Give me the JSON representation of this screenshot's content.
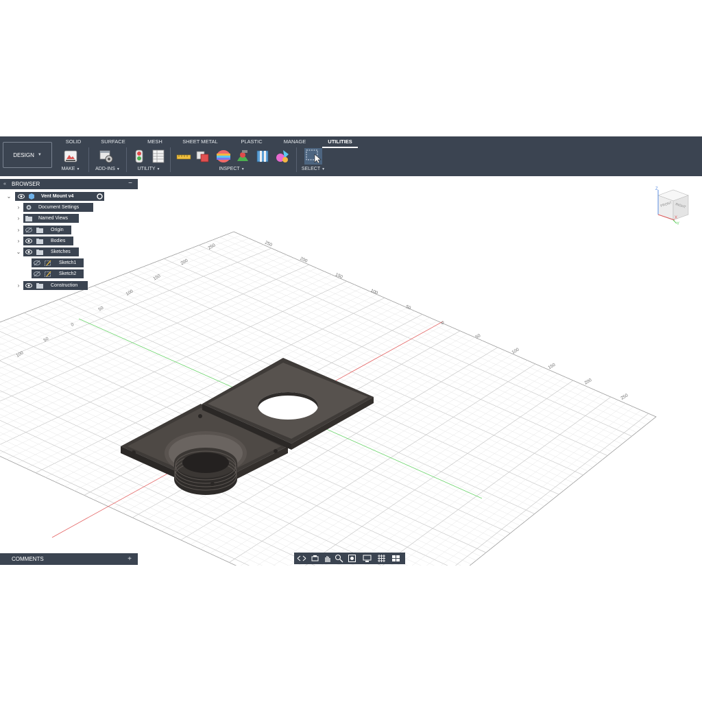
{
  "workspace": {
    "label": "DESIGN"
  },
  "tabs": [
    {
      "label": "SOLID",
      "active": false
    },
    {
      "label": "SURFACE",
      "active": false
    },
    {
      "label": "MESH",
      "active": false
    },
    {
      "label": "SHEET METAL",
      "active": false
    },
    {
      "label": "PLASTIC",
      "active": false
    },
    {
      "label": "MANAGE",
      "active": false
    },
    {
      "label": "UTILITIES",
      "active": true
    }
  ],
  "tool_groups": [
    {
      "label": "MAKE",
      "icons": [
        "3d-print-icon"
      ]
    },
    {
      "label": "ADD-INS",
      "icons": [
        "scripts-addins-icon"
      ]
    },
    {
      "label": "UTILITY",
      "icons": [
        "traffic-light-icon",
        "calculator-table-icon"
      ]
    },
    {
      "label": "INSPECT",
      "icons": [
        "measure-icon",
        "interference-icon",
        "curvature-icon",
        "zebra-icon",
        "section-analysis-icon",
        "accessibility-icon"
      ]
    },
    {
      "label": "SELECT",
      "icons": [
        "window-select-icon"
      ]
    }
  ],
  "browser": {
    "title": "BROWSER",
    "root": "Vent Mount v4",
    "items": [
      {
        "label": "Document Settings"
      },
      {
        "label": "Named Views"
      },
      {
        "label": "Origin"
      },
      {
        "label": "Bodies"
      },
      {
        "label": "Sketches"
      },
      {
        "label": "Sketch1"
      },
      {
        "label": "Sketch2"
      },
      {
        "label": "Construction"
      }
    ]
  },
  "comments": {
    "label": "COMMENTS"
  },
  "axis_ticks": {
    "left": [
      "250",
      "200",
      "150",
      "100",
      "50",
      "0",
      "50",
      "100"
    ],
    "top": [
      "250",
      "200",
      "150",
      "100",
      "50",
      "0"
    ],
    "right": [
      "50",
      "100",
      "150",
      "200",
      "250"
    ]
  },
  "viewcube": {
    "front_label": "FRONT",
    "right_label": "RIGHT",
    "z_label": "Z",
    "x_label": "X",
    "y_label": "Y"
  },
  "colors": {
    "toolbar_bg": "#3b4451",
    "x_axis": "#e05a5a",
    "y_axis": "#5ccf5c",
    "model": "#4a4541",
    "grid": "#d9d9d9"
  },
  "navbar_icons": [
    "orbit-icon",
    "look-at-icon",
    "pan-icon",
    "zoom-icon",
    "fit-icon",
    "display-settings-icon",
    "grid-settings-icon",
    "viewports-icon"
  ]
}
